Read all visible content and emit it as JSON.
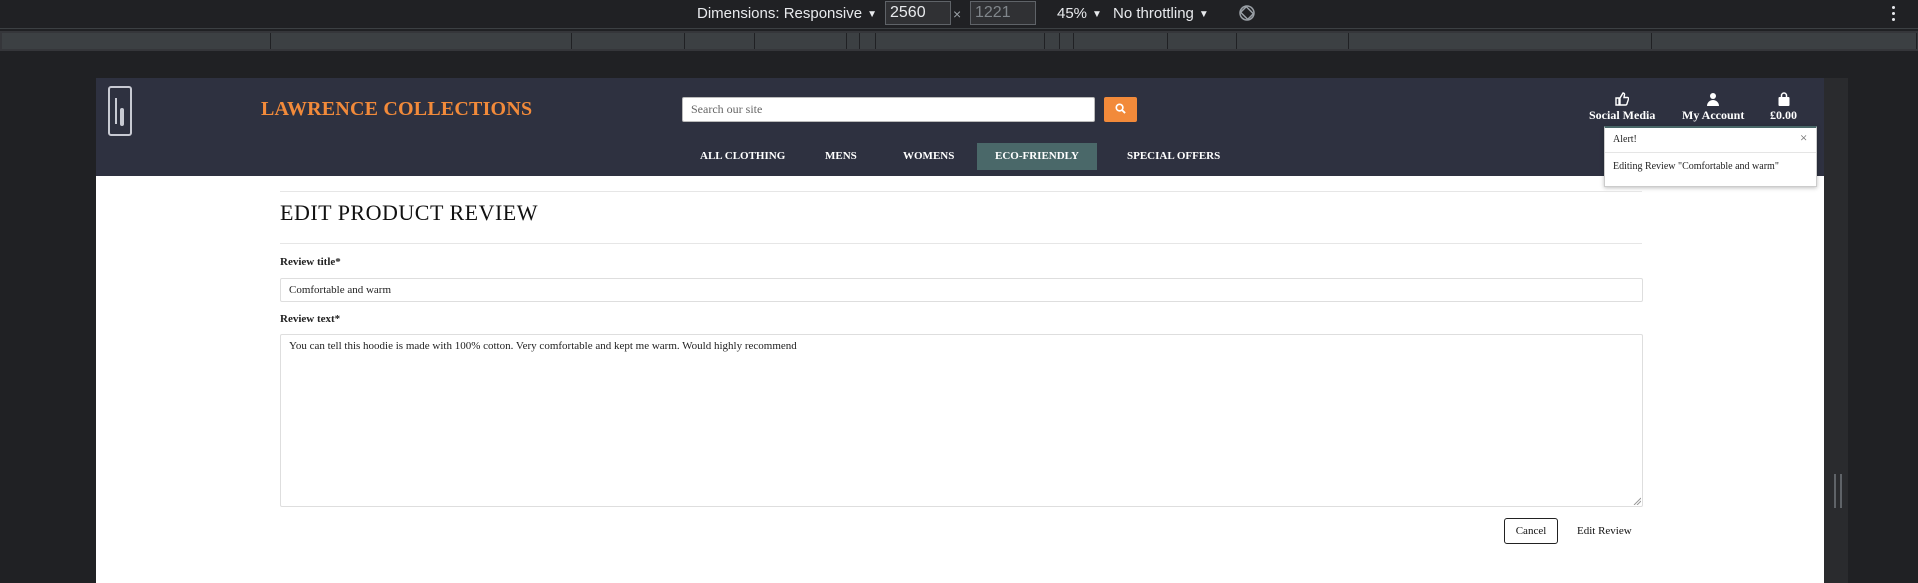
{
  "devtools": {
    "dimensions_label": "Dimensions: Responsive",
    "width_value": "2560",
    "height_placeholder": "1221",
    "times_symbol": "×",
    "zoom": "45%",
    "throttling": "No throttling"
  },
  "site": {
    "brand": "LAWRENCE COLLECTIONS",
    "search_placeholder": "Search our site",
    "header_links": [
      {
        "label": "Social Media",
        "icon": "thumbs-up-icon"
      },
      {
        "label": "My Account",
        "icon": "user-icon"
      },
      {
        "label": "£0.00",
        "icon": "shopping-bag-icon"
      }
    ],
    "nav": [
      {
        "label": "ALL CLOTHING",
        "active": false
      },
      {
        "label": "MENS",
        "active": false
      },
      {
        "label": "WOMENS",
        "active": false
      },
      {
        "label": "ECO-FRIENDLY",
        "active": true
      },
      {
        "label": "SPECIAL OFFERS",
        "active": false
      }
    ],
    "accent_color": "#f28a3a",
    "header_color": "#2e3140",
    "nav_active_color": "#4a6869"
  },
  "alert": {
    "title": "Alert!",
    "close": "×",
    "message": "Editing Review \"Comfortable and warm\""
  },
  "form": {
    "heading": "EDIT PRODUCT REVIEW",
    "title_label": "Review title*",
    "title_value": "Comfortable and warm",
    "text_label": "Review text*",
    "text_value": "You can tell this hoodie is made with 100% cotton. Very comfortable and kept me warm. Would highly recommend",
    "cancel_label": "Cancel",
    "submit_label": "Edit Review"
  }
}
